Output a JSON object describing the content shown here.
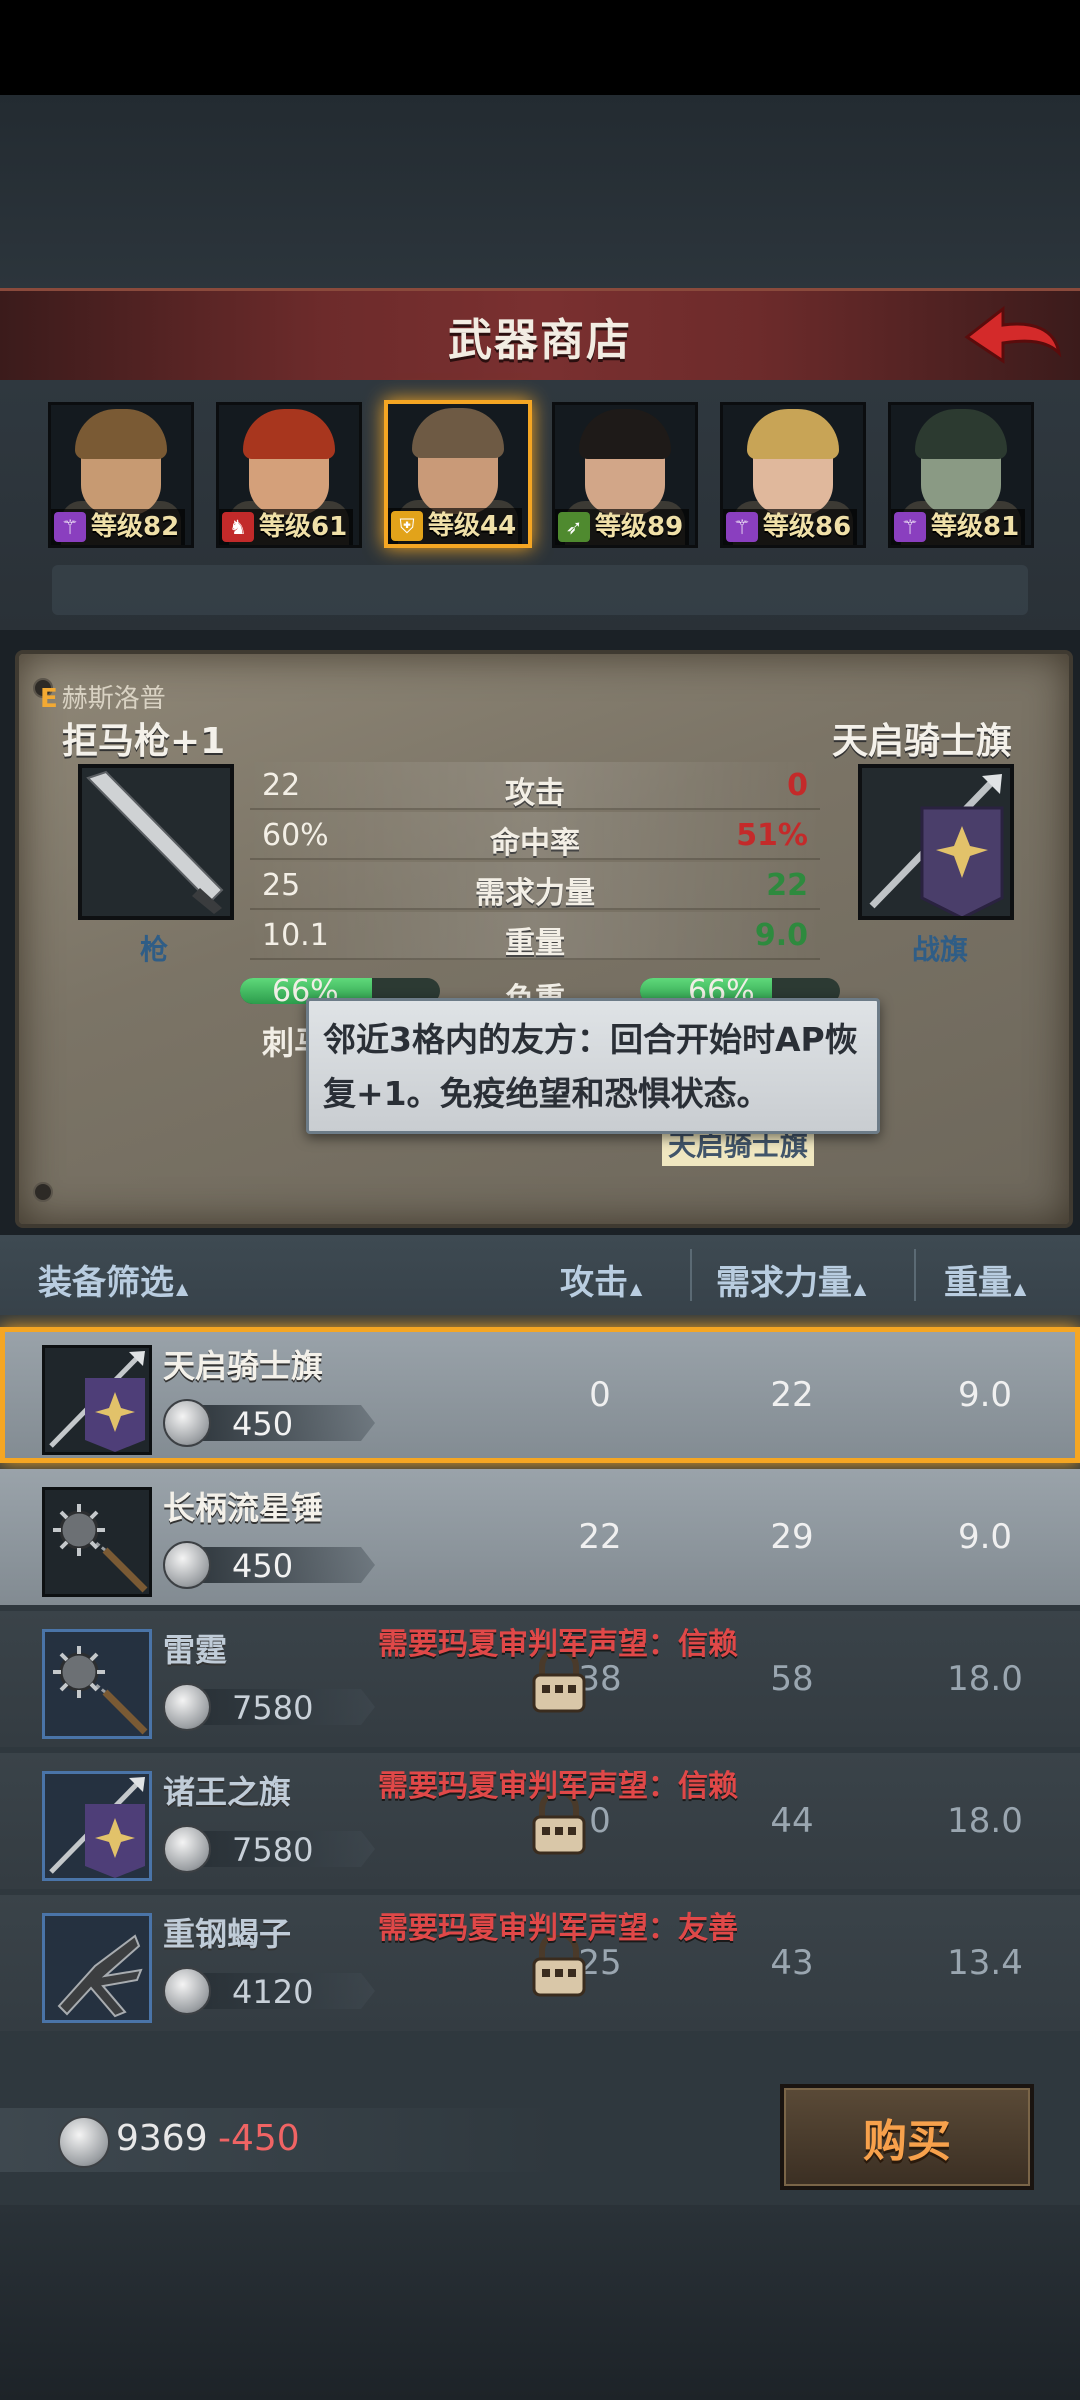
{
  "screen": {
    "title": "武器商店"
  },
  "roster": [
    {
      "level": "等级82",
      "class_icon": "staff-icon",
      "badge_color": "#8a3fbf",
      "skin": "#c79a72",
      "hair": "#7a5a34",
      "selected": false
    },
    {
      "level": "等级61",
      "class_icon": "beast-icon",
      "badge_color": "#c22a2a",
      "skin": "#d4a07a",
      "hair": "#a8361e",
      "selected": false
    },
    {
      "level": "等级44",
      "class_icon": "shield-icon",
      "badge_color": "#e2a31a",
      "skin": "#c99a78",
      "hair": "#6e5a44",
      "selected": true
    },
    {
      "level": "等级89",
      "class_icon": "bow-icon",
      "badge_color": "#4f8a2f",
      "skin": "#d2a688",
      "hair": "#1e1a18",
      "selected": false
    },
    {
      "level": "等级86",
      "class_icon": "staff-icon",
      "badge_color": "#8a3fbf",
      "skin": "#e0b89c",
      "hair": "#c8a456",
      "selected": false
    },
    {
      "level": "等级81",
      "class_icon": "staff-icon",
      "badge_color": "#8a3fbf",
      "skin": "#8a9a84",
      "hair": "#2c3a30",
      "selected": false
    }
  ],
  "compare": {
    "hero_rank": "E",
    "hero_name": "赫斯洛普",
    "left_item": {
      "name": "拒马枪+1",
      "type": "枪"
    },
    "right_item": {
      "name": "天启骑士旗",
      "type": "战旗"
    },
    "stats": [
      {
        "label": "攻击",
        "left": "22",
        "right": "0",
        "right_color": "#c42a2a"
      },
      {
        "label": "命中率",
        "left": "60%",
        "right": "51%",
        "right_color": "#c42a2a"
      },
      {
        "label": "需求力量",
        "left": "25",
        "right": "22",
        "right_color": "#2e8a3e"
      },
      {
        "label": "重量",
        "left": "10.1",
        "right": "9.0",
        "right_color": "#2e8a3e"
      }
    ],
    "load": {
      "label": "负重",
      "left": "66%",
      "right": "66%",
      "left_value": 0.66,
      "right_value": 0.66
    },
    "left_partial_label": "刺马",
    "skill_label": "天启骑士旗",
    "tooltip": "邻近3格内的友方：回合开始时AP恢复+1。免疫绝望和恐惧状态。"
  },
  "list_header": {
    "filter": "装备筛选",
    "attack": "攻击",
    "strength": "需求力量",
    "weight": "重量"
  },
  "items": [
    {
      "name": "天启骑士旗",
      "price": "450",
      "attack": "0",
      "strength": "22",
      "weight": "9.0",
      "state": "available",
      "selected": true,
      "requirement": "",
      "icon": "banner-icon"
    },
    {
      "name": "长柄流星锤",
      "price": "450",
      "attack": "22",
      "strength": "29",
      "weight": "9.0",
      "state": "available",
      "selected": false,
      "requirement": "",
      "icon": "flail-icon"
    },
    {
      "name": "雷霆",
      "price": "7580",
      "attack": "38",
      "strength": "58",
      "weight": "18.0",
      "state": "locked",
      "selected": false,
      "requirement": "需要玛夏审判军声望：信赖",
      "icon": "flail-icon"
    },
    {
      "name": "诸王之旗",
      "price": "7580",
      "attack": "0",
      "strength": "44",
      "weight": "18.0",
      "state": "locked",
      "selected": false,
      "requirement": "需要玛夏审判军声望：信赖",
      "icon": "banner-icon"
    },
    {
      "name": "重钢蝎子",
      "price": "4120",
      "attack": "25",
      "strength": "43",
      "weight": "13.4",
      "state": "locked",
      "selected": false,
      "requirement": "需要玛夏审判军声望：友善",
      "icon": "claw-icon"
    }
  ],
  "footer": {
    "money": "9369",
    "delta": "-450",
    "buy_label": "购买"
  }
}
